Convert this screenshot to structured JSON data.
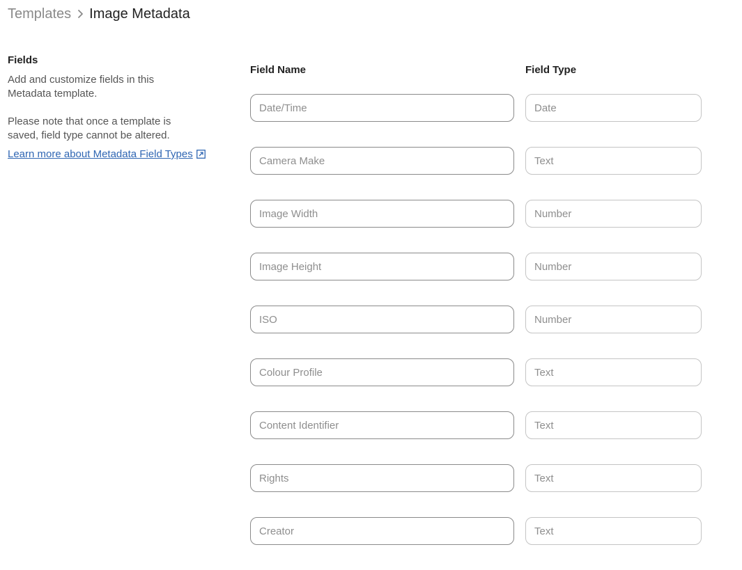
{
  "breadcrumb": {
    "parent": "Templates",
    "current": "Image Metadata"
  },
  "sidebar": {
    "title": "Fields",
    "description": "Add and customize fields in this Metadata template.",
    "note": "Please note that once a template is saved, field type cannot be altered.",
    "link_label": "Learn more about Metadata Field Types",
    "link_icon": "external-link-icon"
  },
  "columns": {
    "name_header": "Field Name",
    "type_header": "Field Type"
  },
  "fields": [
    {
      "name": "Date/Time",
      "type": "Date"
    },
    {
      "name": "Camera Make",
      "type": "Text"
    },
    {
      "name": "Image Width",
      "type": "Number"
    },
    {
      "name": "Image Height",
      "type": "Number"
    },
    {
      "name": "ISO",
      "type": "Number"
    },
    {
      "name": "Colour Profile",
      "type": "Text"
    },
    {
      "name": "Content Identifier",
      "type": "Text"
    },
    {
      "name": "Rights",
      "type": "Text"
    },
    {
      "name": "Creator",
      "type": "Text"
    }
  ],
  "colors": {
    "link": "#2f66b3",
    "breadcrumb_parent": "#8a8a8a",
    "input_border": "#b8b8b8",
    "placeholder": "#8e8e8e"
  }
}
